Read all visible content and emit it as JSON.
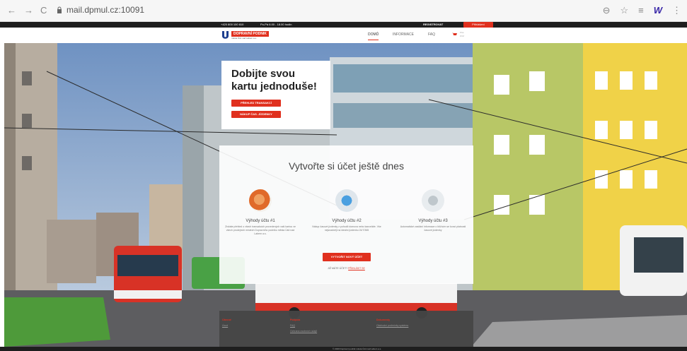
{
  "browser": {
    "url": "mail.dpmul.cz:10091",
    "back": "←",
    "forward": "→",
    "reload": "C",
    "icons": [
      "zoom-icon",
      "star-icon",
      "reading-list-icon",
      "extension-icon",
      "menu-icon"
    ],
    "zoom": "⊖",
    "star": "☆",
    "reading": "≡",
    "extension": "W",
    "kebab": "⋮"
  },
  "topbar": {
    "phone": "+420 800 100 610",
    "hours": "Po-Pá 6.00 - 18.00 hodin",
    "register": "REGISTROVAT",
    "login": "Přihlášení"
  },
  "header": {
    "logo_name": "DOPRAVNÍ PODNIK",
    "logo_sub": "města Ústí nad Labem a.s.",
    "menu": [
      "DOMŮ",
      "INFORMACE",
      "FAQ"
    ],
    "cart_count": "0 ks",
    "cart_price": "0 Kč"
  },
  "card1": {
    "title": "Dobijte svou kartu jednoduše!",
    "btn_transactions": "PŘEHLED TRANSAKCÍ",
    "btn_ticket": "NÁKUP ČAS. JÍZDENKY"
  },
  "card2": {
    "title": "Vytvořte si účet ještě dnes",
    "benefits": [
      {
        "title": "Výhody účtu #1",
        "text": "Získáte přehled o všech transakcích provedených vaší kartou ve všech prodejních místech Dopravního podniku města Ústí nad Labem a.s."
      },
      {
        "title": "Výhody účtu #2",
        "text": "Nákup časové jízdenky z pohodlí domova nebo kanceláře. Vše nejsnadněji na ideální jízdenku 24/7/365"
      },
      {
        "title": "Výhody účtu #3",
        "text": "Automatické zasílání informace o blížícím se konci platnosti časové jízdenky"
      }
    ],
    "create_btn": "VYTVOŘIT NOVÝ ÚČET",
    "have_account": "JIŽ MÁTE ÚČET?",
    "login_link": "PŘIHLÁSIT SE"
  },
  "footer": {
    "cols": [
      {
        "title": "Obecné",
        "links": [
          "Úvod"
        ]
      },
      {
        "title": "Podpora",
        "links": [
          "FAQ",
          "Ochrana osobních údajů"
        ]
      },
      {
        "title": "Dokumenty",
        "links": [
          "Obchodní podmínky systému"
        ]
      }
    ],
    "copyright": "© 2020 Dopravní podnik města Ústí nad Labem a.s."
  },
  "colors": {
    "accent": "#e0301e",
    "dark": "#1e1e1e"
  }
}
